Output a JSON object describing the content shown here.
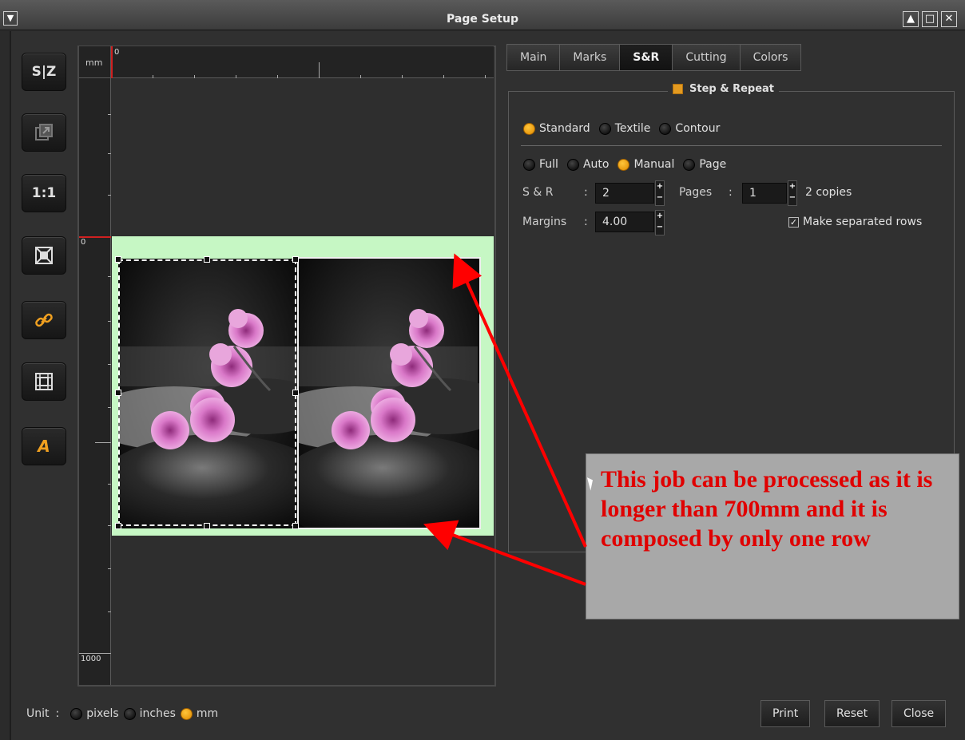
{
  "window": {
    "title": "Page Setup"
  },
  "toolbar": [
    {
      "name": "mirror-tool",
      "label": "S|Z"
    },
    {
      "name": "export-tool",
      "label": ""
    },
    {
      "name": "actual-size-tool",
      "label": "1:1"
    },
    {
      "name": "fit-tool",
      "label": ""
    },
    {
      "name": "link-tool",
      "label": ""
    },
    {
      "name": "crop-tool",
      "label": ""
    },
    {
      "name": "text-tool",
      "label": "A"
    }
  ],
  "canvas": {
    "unit_label": "mm",
    "top_ruler_zero": "0",
    "left_ruler_zero": "0",
    "left_ruler_max": "1000"
  },
  "tabs": [
    {
      "label": "Main",
      "active": false
    },
    {
      "label": "Marks",
      "active": false
    },
    {
      "label": "S&R",
      "active": true
    },
    {
      "label": "Cutting",
      "active": false
    },
    {
      "label": "Colors",
      "active": false
    }
  ],
  "step_repeat": {
    "title": "Step & Repeat",
    "enabled": true,
    "mode_options": [
      {
        "label": "Standard",
        "selected": true
      },
      {
        "label": "Textile",
        "selected": false
      },
      {
        "label": "Contour",
        "selected": false
      }
    ],
    "fill_options": [
      {
        "label": "Full",
        "selected": false
      },
      {
        "label": "Auto",
        "selected": false
      },
      {
        "label": "Manual",
        "selected": true
      },
      {
        "label": "Page",
        "selected": false
      }
    ],
    "sr_label": "S & R",
    "sr_value": "2",
    "pages_label": "Pages",
    "pages_value": "1",
    "copies_text": "2 copies",
    "margins_label": "Margins",
    "margins_value": "4.00",
    "separate_rows_label": "Make separated rows",
    "separate_rows_checked": true,
    "colon": ":"
  },
  "units": {
    "label": "Unit",
    "colon": ":",
    "options": [
      {
        "label": "pixels",
        "selected": false
      },
      {
        "label": "inches",
        "selected": false
      },
      {
        "label": "mm",
        "selected": true
      }
    ]
  },
  "buttons": {
    "print": "Print",
    "reset": "Reset",
    "close": "Close"
  },
  "annotation": {
    "text": "This job can be processed as it is longer than 700mm and it is composed by only one row",
    "color": "#e00000"
  },
  "colors": {
    "accent": "#f0a020",
    "paper": "#c6f7c4",
    "arrow": "#ff0000"
  }
}
